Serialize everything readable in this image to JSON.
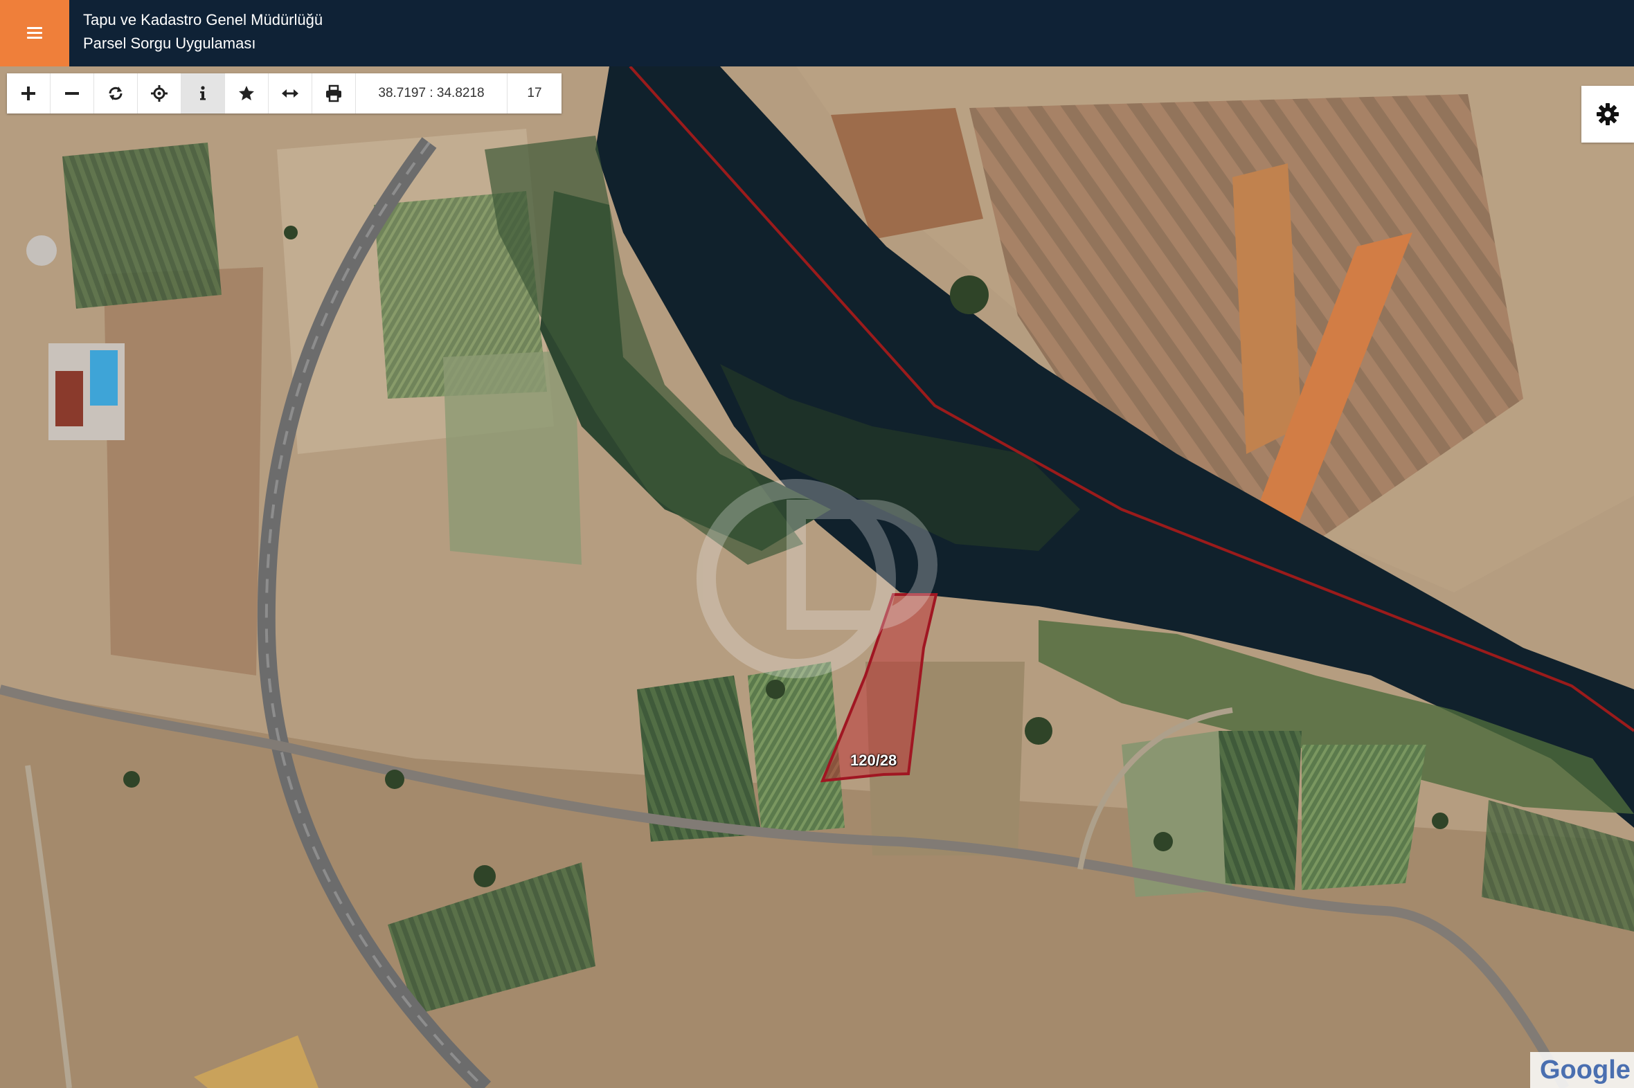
{
  "header": {
    "title_line1": "Tapu ve Kadastro Genel Müdürlüğü",
    "title_line2": "Parsel Sorgu Uygulaması",
    "menu_icon": "hamburger-icon",
    "accent_color": "#ef7f3a",
    "bar_color": "#0f2236"
  },
  "toolbar": {
    "tools": [
      "zoom-in",
      "zoom-out",
      "refresh",
      "locate",
      "info",
      "favorite",
      "measure",
      "print"
    ],
    "active_tool": "info",
    "coordinates": "38.7197 : 34.8218",
    "zoom_level": "17"
  },
  "map": {
    "parcel_label": "120/28",
    "parcel_color": "#c0242c",
    "boundary_color": "#9b1b1b",
    "attribution": "Google"
  },
  "settings": {
    "icon": "gear-icon"
  }
}
